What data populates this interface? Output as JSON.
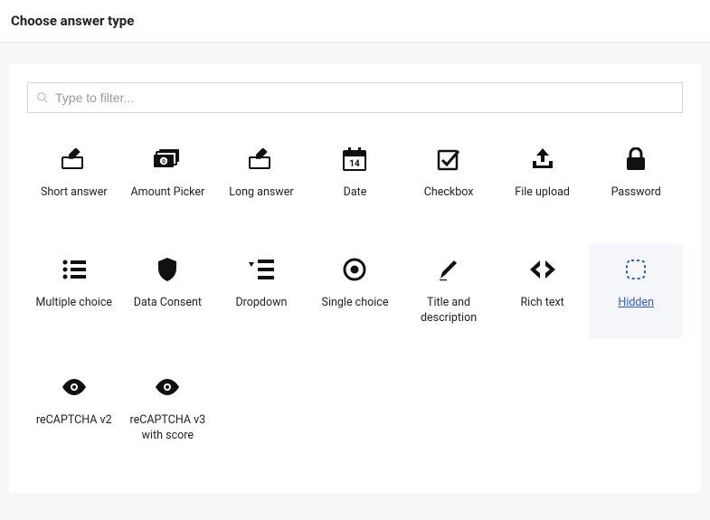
{
  "header": {
    "title": "Choose answer type"
  },
  "filter": {
    "placeholder": "Type to filter..."
  },
  "types": [
    {
      "id": "short-answer",
      "icon": "pencil-box",
      "label": "Short answer"
    },
    {
      "id": "amount-picker",
      "icon": "money-stack",
      "label": "Amount Picker"
    },
    {
      "id": "long-answer",
      "icon": "pencil-box",
      "label": "Long answer"
    },
    {
      "id": "date",
      "icon": "calendar",
      "label": "Date",
      "calendar_day": "14"
    },
    {
      "id": "checkbox",
      "icon": "checkbox",
      "label": "Checkbox"
    },
    {
      "id": "file-upload",
      "icon": "upload",
      "label": "File upload"
    },
    {
      "id": "password",
      "icon": "lock",
      "label": "Password"
    },
    {
      "id": "multiple-choice",
      "icon": "bullet-list",
      "label": "Multiple choice"
    },
    {
      "id": "data-consent",
      "icon": "shield",
      "label": "Data Consent"
    },
    {
      "id": "dropdown",
      "icon": "dropdown-list",
      "label": "Dropdown"
    },
    {
      "id": "single-choice",
      "icon": "radio-dot",
      "label": "Single choice"
    },
    {
      "id": "title-desc",
      "icon": "pen",
      "label": "Title and description"
    },
    {
      "id": "rich-text",
      "icon": "code-angle",
      "label": "Rich text"
    },
    {
      "id": "hidden",
      "icon": "dashed-square",
      "label": "Hidden",
      "selected": true
    },
    {
      "id": "recaptcha-v2",
      "icon": "eye",
      "label": "reCAPTCHA v2"
    },
    {
      "id": "recaptcha-v3",
      "icon": "eye",
      "label": "reCAPTCHA v3 with score"
    }
  ]
}
